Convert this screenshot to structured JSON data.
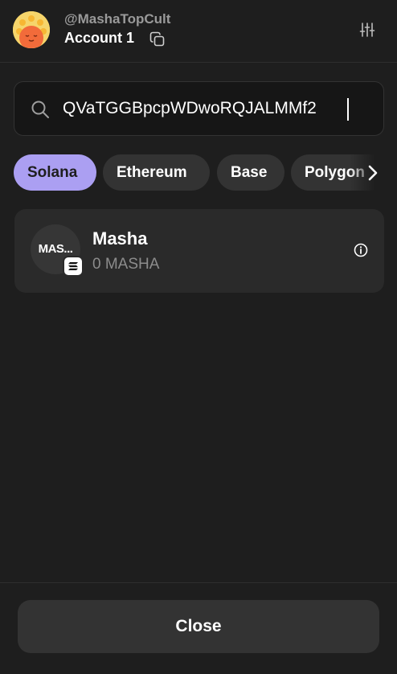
{
  "header": {
    "handle": "@MashaTopCult",
    "account_name": "Account 1",
    "avatar_icon": "smiling-sun-avatar",
    "copy_icon": "copy-icon",
    "settings_icon": "sliders-icon"
  },
  "search": {
    "value": "QVaTGGBpcpWDwoRQJALMMf2",
    "icon": "search-icon"
  },
  "networks": {
    "selected": "Solana",
    "items": [
      {
        "label": "Solana"
      },
      {
        "label": "Ethereum"
      },
      {
        "label": "Base"
      },
      {
        "label": "Polygon"
      }
    ]
  },
  "tokens": [
    {
      "logo_text": "MAS...",
      "name": "Masha",
      "balance": "0 MASHA",
      "chain_icon": "solana-icon"
    }
  ],
  "footer": {
    "close_label": "Close"
  },
  "colors": {
    "background": "#1e1e1e",
    "card": "#2a2a2a",
    "chip": "#333333",
    "accent": "#ab9ff2",
    "muted_text": "#8c8c8c"
  }
}
